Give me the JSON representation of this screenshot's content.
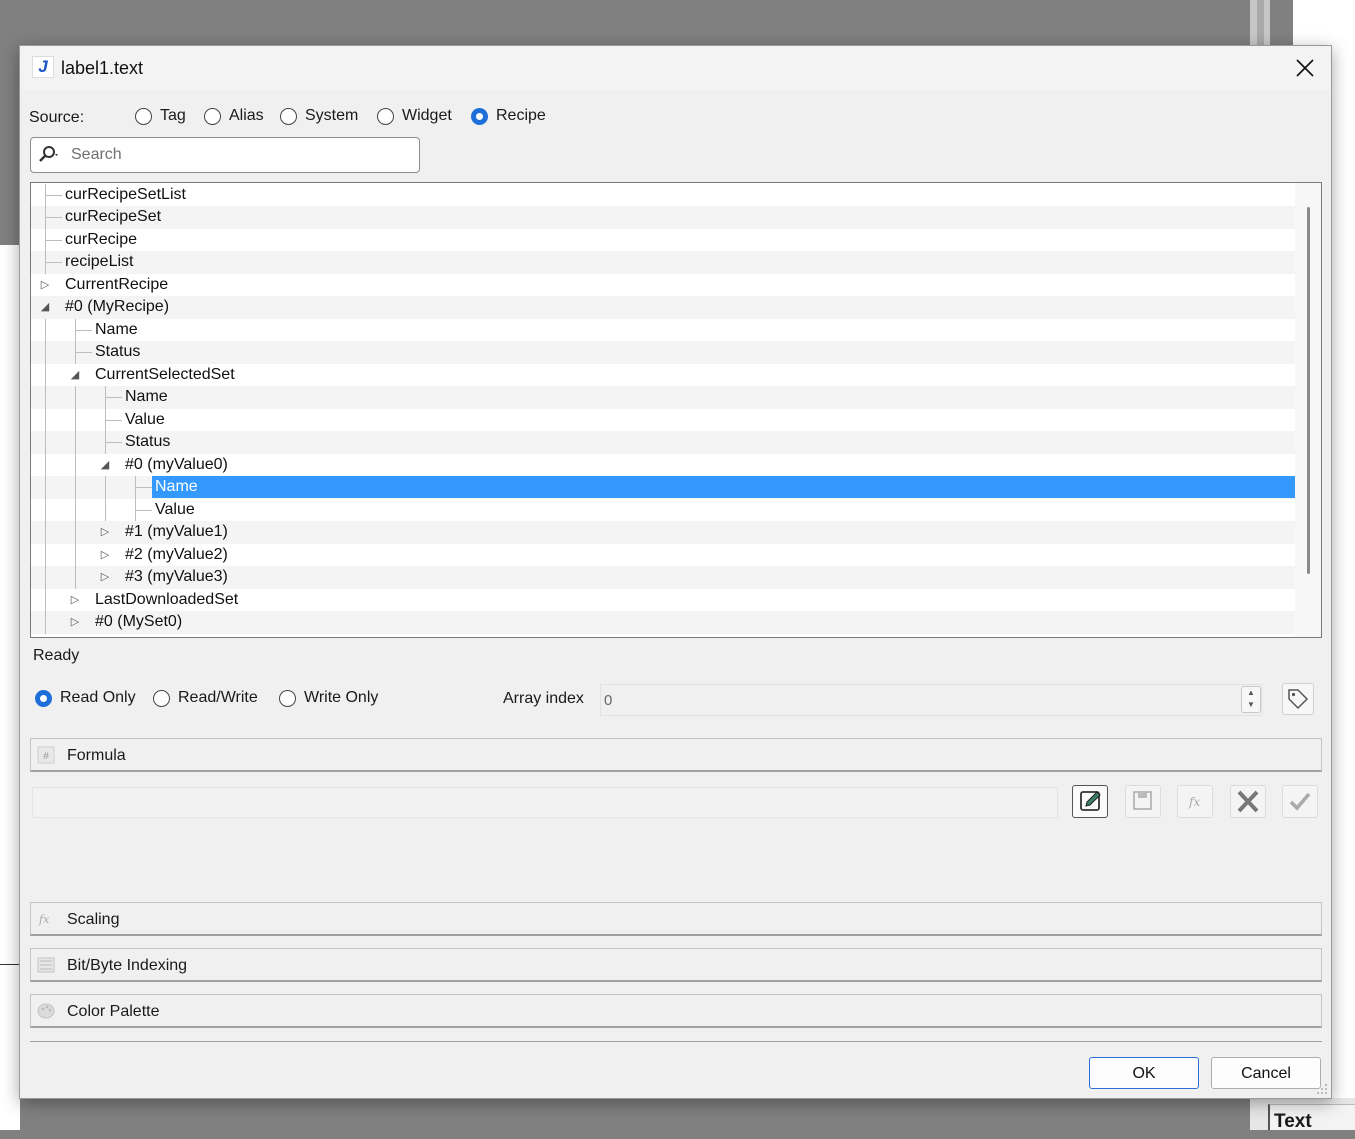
{
  "dialog": {
    "title": "label1.text",
    "app_icon_glyph": "J"
  },
  "source": {
    "label": "Source:",
    "options": [
      "Tag",
      "Alias",
      "System",
      "Widget",
      "Recipe"
    ],
    "selected": "Recipe"
  },
  "search": {
    "placeholder": "Search",
    "value": ""
  },
  "tree": {
    "items": [
      {
        "label": "curRecipeSetList",
        "depth": 0,
        "expander": "none"
      },
      {
        "label": "curRecipeSet",
        "depth": 0,
        "expander": "none"
      },
      {
        "label": "curRecipe",
        "depth": 0,
        "expander": "none"
      },
      {
        "label": "recipeList",
        "depth": 0,
        "expander": "none"
      },
      {
        "label": "CurrentRecipe",
        "depth": 0,
        "expander": "collapsed"
      },
      {
        "label": "#0 (MyRecipe)",
        "depth": 0,
        "expander": "expanded"
      },
      {
        "label": "Name",
        "depth": 1,
        "expander": "none"
      },
      {
        "label": "Status",
        "depth": 1,
        "expander": "none"
      },
      {
        "label": "CurrentSelectedSet",
        "depth": 1,
        "expander": "expanded"
      },
      {
        "label": "Name",
        "depth": 2,
        "expander": "none"
      },
      {
        "label": "Value",
        "depth": 2,
        "expander": "none"
      },
      {
        "label": "Status",
        "depth": 2,
        "expander": "none"
      },
      {
        "label": "#0 (myValue0)",
        "depth": 2,
        "expander": "expanded"
      },
      {
        "label": "Name",
        "depth": 3,
        "expander": "none",
        "selected": true
      },
      {
        "label": "Value",
        "depth": 3,
        "expander": "none"
      },
      {
        "label": "#1 (myValue1)",
        "depth": 2,
        "expander": "collapsed"
      },
      {
        "label": "#2 (myValue2)",
        "depth": 2,
        "expander": "collapsed"
      },
      {
        "label": "#3 (myValue3)",
        "depth": 2,
        "expander": "collapsed"
      },
      {
        "label": "LastDownloadedSet",
        "depth": 1,
        "expander": "collapsed"
      },
      {
        "label": "#0 (MySet0)",
        "depth": 1,
        "expander": "collapsed"
      }
    ]
  },
  "status_text": "Ready",
  "access": {
    "options": [
      "Read Only",
      "Read/Write",
      "Write Only"
    ],
    "selected": "Read Only"
  },
  "array_index": {
    "label": "Array index",
    "value": "0"
  },
  "sections": {
    "formula": "Formula",
    "scaling": "Scaling",
    "bit_byte": "Bit/Byte Indexing",
    "color_palette": "Color Palette"
  },
  "formula_toolbar": {
    "icons": [
      "edit-icon",
      "save-icon",
      "function-icon",
      "clear-icon",
      "apply-check-icon"
    ]
  },
  "buttons": {
    "ok": "OK",
    "cancel": "Cancel"
  },
  "background": {
    "side_tab_label": "Text"
  },
  "colors": {
    "accent": "#1e6fd9",
    "selection": "#3399ff"
  }
}
